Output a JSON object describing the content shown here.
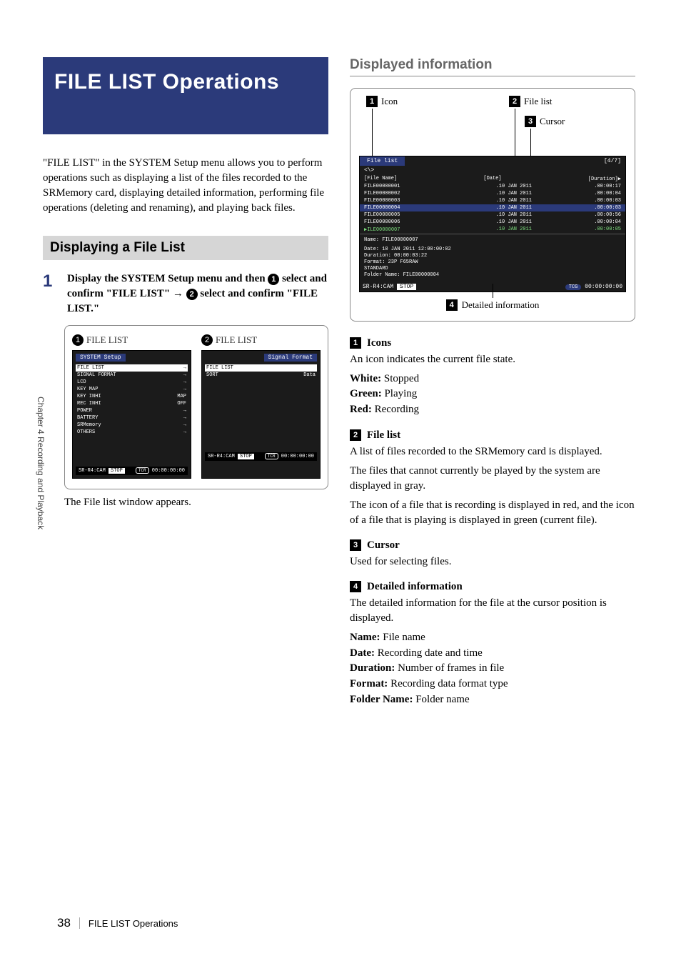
{
  "sideTab": "Chapter 4  Recording and Playback",
  "footer": {
    "page": "38",
    "title": "FILE LIST Operations"
  },
  "banner": {
    "title": "FILE LIST Operations"
  },
  "intro": "\"FILE LIST\" in the SYSTEM Setup menu allows you to perform operations such as displaying a list of the files recorded to the SRMemory card, displaying detailed information, performing file operations (deleting and renaming), and playing back files.",
  "subhead": "Displaying a File List",
  "step1": {
    "num": "1",
    "parts": {
      "a": "Display the SYSTEM Setup menu and then ",
      "b": " select and confirm \"FILE LIST\" → ",
      "c": " select and confirm \"FILE LIST.\""
    }
  },
  "menuFig": {
    "label1": "FILE LIST",
    "label2": "FILE LIST",
    "systemTitle": "SYSTEM Setup",
    "items": [
      {
        "l": "FILE LIST",
        "r": "→",
        "hi": true
      },
      {
        "l": "SIGNAL FORMAT",
        "r": "→"
      },
      {
        "l": "LCD",
        "r": "→"
      },
      {
        "l": "KEY MAP",
        "r": "→"
      },
      {
        "l": "KEY INHI",
        "r": "MAP"
      },
      {
        "l": "REC INHI",
        "r": "OFF"
      },
      {
        "l": "POWER",
        "r": "→"
      },
      {
        "l": "BATTERY",
        "r": "→"
      },
      {
        "l": "SRMemory",
        "r": "→"
      },
      {
        "l": "OTHERS",
        "r": "→"
      }
    ],
    "signalTitle": "Signal Format",
    "items2": [
      {
        "l": "FILE LIST",
        "r": ""
      },
      {
        "l": "SORT",
        "r": "Data"
      }
    ],
    "footerLeft": "SR-R4:CAM",
    "footerStop": "STOP",
    "footerTcr": "TCR",
    "footerTime": "00:00:00:00"
  },
  "caption": "The File list window appears.",
  "rightHead": "Displayed information",
  "callouts": {
    "c1": "Icon",
    "c2": "File list",
    "c3": "Cursor",
    "c4": "Detailed information"
  },
  "filePanel": {
    "tab": "File list",
    "count": "[4/7]",
    "nav": "<\\>",
    "cols": {
      "c1": "[File Name]",
      "c2": "[Date]",
      "c3": "[Duration]▶"
    },
    "rows": [
      {
        "c1": "FILE00000001",
        "c2": ".10 JAN 2011",
        "c3": ".00:00:17"
      },
      {
        "c1": "FILE00000002",
        "c2": ".10 JAN 2011",
        "c3": ".00:00:04"
      },
      {
        "c1": "FILE00000003",
        "c2": ".10 JAN 2011",
        "c3": ".00:00:03"
      },
      {
        "c1": "FILE00000004",
        "c2": ".10 JAN 2011",
        "c3": ".00:00:03",
        "sel": true
      },
      {
        "c1": "FILE00000005",
        "c2": ".10 JAN 2011",
        "c3": ".00:00:56"
      },
      {
        "c1": "FILE00000006",
        "c2": ".10 JAN 2011",
        "c3": ".00:00:04"
      },
      {
        "c1": "▶ILE00000007",
        "c2": ".10 JAN 2011",
        "c3": ".00:00:05",
        "green": true
      }
    ],
    "detail": {
      "name": "Name: FILE00000007",
      "date": "Date: 10 JAN 2011   12:00:00:02",
      "dur": "Duration:   00:00:03:22",
      "fmt": "Format: 23P F65RAW",
      "fmt2": "        STANDARD",
      "folder": "Folder Name: FILE00000004"
    },
    "footerLeft": "SR-R4:CAM",
    "footerStop": "STOP",
    "footerTcr": "TCG",
    "footerTime": "00:00:00:00"
  },
  "sec1": {
    "head": "Icons",
    "body": "An icon indicates the current file state.",
    "kv": [
      {
        "k": "White:",
        "v": " Stopped"
      },
      {
        "k": "Green:",
        "v": " Playing"
      },
      {
        "k": "Red:",
        "v": " Recording"
      }
    ]
  },
  "sec2": {
    "head": "File list",
    "body1": "A list of files recorded to the SRMemory card is displayed.",
    "body2": "The files that cannot currently be played by the system are displayed in gray.",
    "body3": "The icon of a file that is recording is displayed in red, and the icon of a file that is playing is displayed in green (current file)."
  },
  "sec3": {
    "head": "Cursor",
    "body": "Used for selecting files."
  },
  "sec4": {
    "head": "Detailed information",
    "body": "The detailed information for the file at the cursor position is displayed.",
    "kv": [
      {
        "k": "Name:",
        "v": " File name"
      },
      {
        "k": "Date:",
        "v": " Recording date and time"
      },
      {
        "k": "Duration:",
        "v": " Number of frames in file"
      },
      {
        "k": "Format:",
        "v": " Recording data format type"
      },
      {
        "k": "Folder Name:",
        "v": " Folder name"
      }
    ]
  }
}
